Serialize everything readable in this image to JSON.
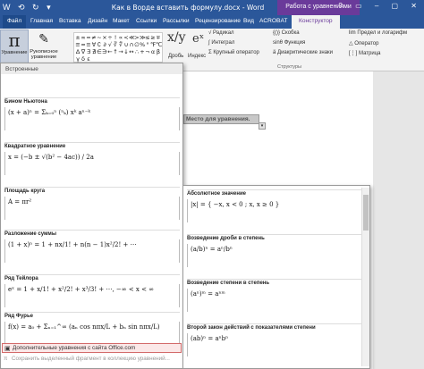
{
  "titlebar": {
    "quick_access": "W ⟲ ↻ ▾",
    "title": "Как в Ворде вставить формулу.docx - Word",
    "context_tab": "Работа с уравнениями",
    "window_controls": "? ▭ ‒ ▢ ✕"
  },
  "tabs": [
    "Файл",
    "Главная",
    "Вставка",
    "Дизайн",
    "Макет",
    "Ссылки",
    "Рассылки",
    "Рецензирование",
    "Вид",
    "ACROBAT",
    "Конструктор"
  ],
  "ribbon": {
    "equation_label": "Уравнение",
    "ink_label": "Рукописное уравнение",
    "text_toggle": "abc",
    "symbols": [
      "±",
      "∞",
      "=",
      "≠",
      "~",
      "×",
      "÷",
      "!",
      "∝",
      "<",
      "≪",
      ">",
      "≫",
      "≤",
      "≥",
      "∓",
      "≅",
      "≈",
      "≡",
      "∀",
      "∁",
      "∂",
      "√",
      "∛",
      "∜",
      "∪",
      "∩",
      "∅",
      "%",
      "°",
      "℉",
      "℃",
      "∆",
      "∇",
      "∃",
      "∄",
      "∈",
      "∋",
      "←",
      "↑",
      "→",
      "↓",
      "↔",
      "∴",
      "+",
      "¬",
      "α",
      "β",
      "γ",
      "δ",
      "ε"
    ],
    "fraction": "Дробь",
    "script": "Индекс",
    "radical": "Радикал",
    "integral": "Интеграл",
    "large_operator": "Крупный оператор",
    "bracket": "Скобка",
    "function": "Функция",
    "accent": "Диакритические знаки",
    "limit": "Предел и логарифм",
    "operator": "Оператор",
    "matrix": "Матрица",
    "group_structures": "Структуры"
  },
  "gallery": {
    "header": "Встроенные",
    "entries": [
      {
        "label": "Бином Ньютона",
        "formula": "(x + a)ⁿ = Σₖ₌₀ⁿ (ⁿₖ) xᵏ aⁿ⁻ᵏ"
      },
      {
        "label": "Квадратное уравнение",
        "formula": "x = (−b ± √(b² − 4ac)) / 2a"
      },
      {
        "label": "Площадь круга",
        "formula": "A = πr²"
      },
      {
        "label": "Разложение суммы",
        "formula": "(1 + x)ⁿ = 1 + nx/1! + n(n − 1)x²/2! + ⋯"
      },
      {
        "label": "Ряд Тейлора",
        "formula": "eˣ = 1 + x/1! + x²/2! + x³/3! + ⋯,   −∞ < x < ∞"
      },
      {
        "label": "Ряд Фурье",
        "formula": "f(x) = a₀ + Σₙ₌₁^∞ (aₙ cos nπx/L + bₙ sin nπx/L)"
      }
    ],
    "more_link": "Дополнительные уравнения с сайта Office.com",
    "save_selection": "Сохранить выделенный фрагмент в коллекцию уравнений..."
  },
  "document": {
    "placeholder": "Место для уравнения."
  },
  "gallery2": {
    "entries": [
      {
        "label": "Абсолютное значение",
        "formula": "|x| = { −x,  x < 0 ;  x,  x ≥ 0 }"
      },
      {
        "label": "Возведение дроби в степень",
        "formula": "(a/b)ⁿ = aⁿ/bⁿ"
      },
      {
        "label": "Возведение степени в степень",
        "formula": "(aⁿ)ᵐ = aⁿᵐ"
      },
      {
        "label": "Второй закон действий с показателями степени",
        "formula": "(ab)ⁿ = aⁿbⁿ"
      }
    ]
  }
}
